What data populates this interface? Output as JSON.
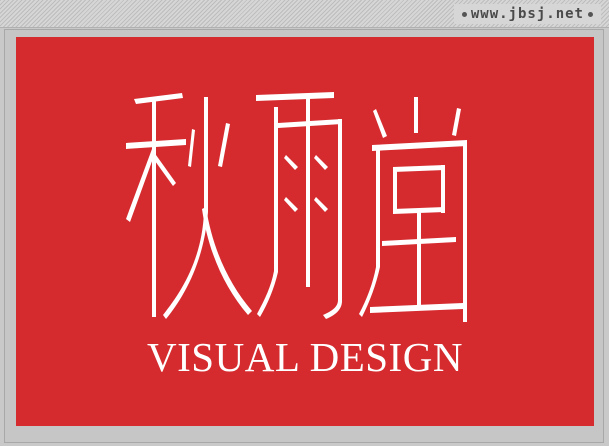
{
  "watermark": {
    "site": "www.jbsj.net"
  },
  "poster": {
    "logo_lettering": "秋雨堂",
    "tagline": "VISUAL DESIGN"
  },
  "colors": {
    "poster_red": "#d52b2f",
    "text_white": "#ffffff",
    "frame_gray": "#c6c6c6"
  }
}
